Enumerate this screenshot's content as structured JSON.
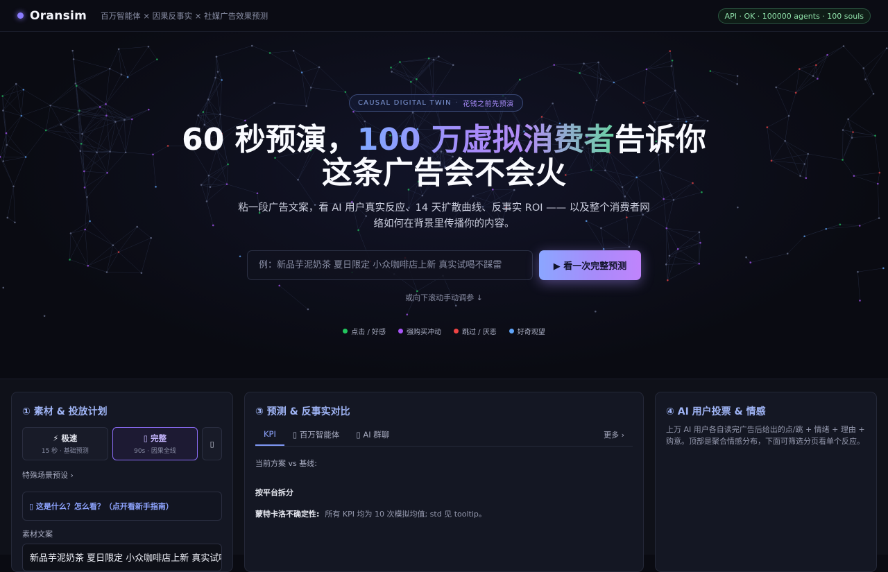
{
  "topbar": {
    "brand": "Oransim",
    "tagline": "百万智能体 × 因果反事实 × 社媒广告效果预测",
    "api_status": "API · OK · 100000 agents · 100 souls"
  },
  "hero": {
    "badge_main": "CAUSAL DIGITAL TWIN",
    "badge_sep": "·",
    "badge_sub": "花钱之前先预演",
    "headline_part1": "60 秒预演，",
    "headline_highlight": "100 万虚拟消费者",
    "headline_part2": "告诉你",
    "headline_line2": "这条广告会不会火",
    "subtext": "粘一段广告文案，看 AI 用户真实反应、14 天扩散曲线、反事实 ROI —— 以及整个消费者网络如何在背景里传播你的内容。",
    "input_placeholder": "例：新品芋泥奶茶 夏日限定 小众咖啡店上新 真实试喝不踩雷",
    "cta_label": "▶ 看一次完整预测",
    "scroll_hint": "或向下滚动手动调参 ↓",
    "legend": [
      {
        "label": "点击 / 好感",
        "color": "#22c55e"
      },
      {
        "label": "强购买冲动",
        "color": "#a855f7"
      },
      {
        "label": "跳过 / 厌恶",
        "color": "#ef4444"
      },
      {
        "label": "好奇观望",
        "color": "#60a5fa"
      }
    ]
  },
  "panel_material": {
    "title": "① 素材 & 投放计划",
    "modes": [
      {
        "title": "⚡ 极速",
        "sub": "15 秒 · 基础预测"
      },
      {
        "title": "▯ 完整",
        "sub": "90s · 因果全线"
      }
    ],
    "mode_more": "▯",
    "special_presets": "特殊场景预设 ›",
    "guide": "▯ 这是什么？怎么看？（点开看新手指南）",
    "copy_label": "素材文案",
    "copy_value": "新品芋泥奶茶 夏日限定 小众咖啡店上新 真实试喝不踩雷"
  },
  "panel_forecast": {
    "title": "③ 预测 & 反事实对比",
    "tabs": [
      "KPI",
      "▯ 百万智能体",
      "▯ AI 群聊"
    ],
    "more": "更多 ›",
    "current_vs_baseline": "当前方案 vs 基线:",
    "by_platform": "按平台拆分",
    "mc_label": "蒙特卡洛不确定性:",
    "mc_text": "所有 KPI 均为 10 次模拟均值; std 见 tooltip。"
  },
  "panel_vote": {
    "title": "④ AI 用户投票 & 情感",
    "desc": "上万 AI 用户各自读完广告后给出的点/跳 + 情绪 + 理由 + 购意。顶部是聚合情感分布，下面可筛选分页看单个反应。"
  },
  "colors": {
    "accent": "#a78bfa",
    "accent_blue": "#7fa8ff",
    "accent_green": "#6ad1a3",
    "background": "#0a0b12",
    "ok_green": "#8fe0a9"
  }
}
